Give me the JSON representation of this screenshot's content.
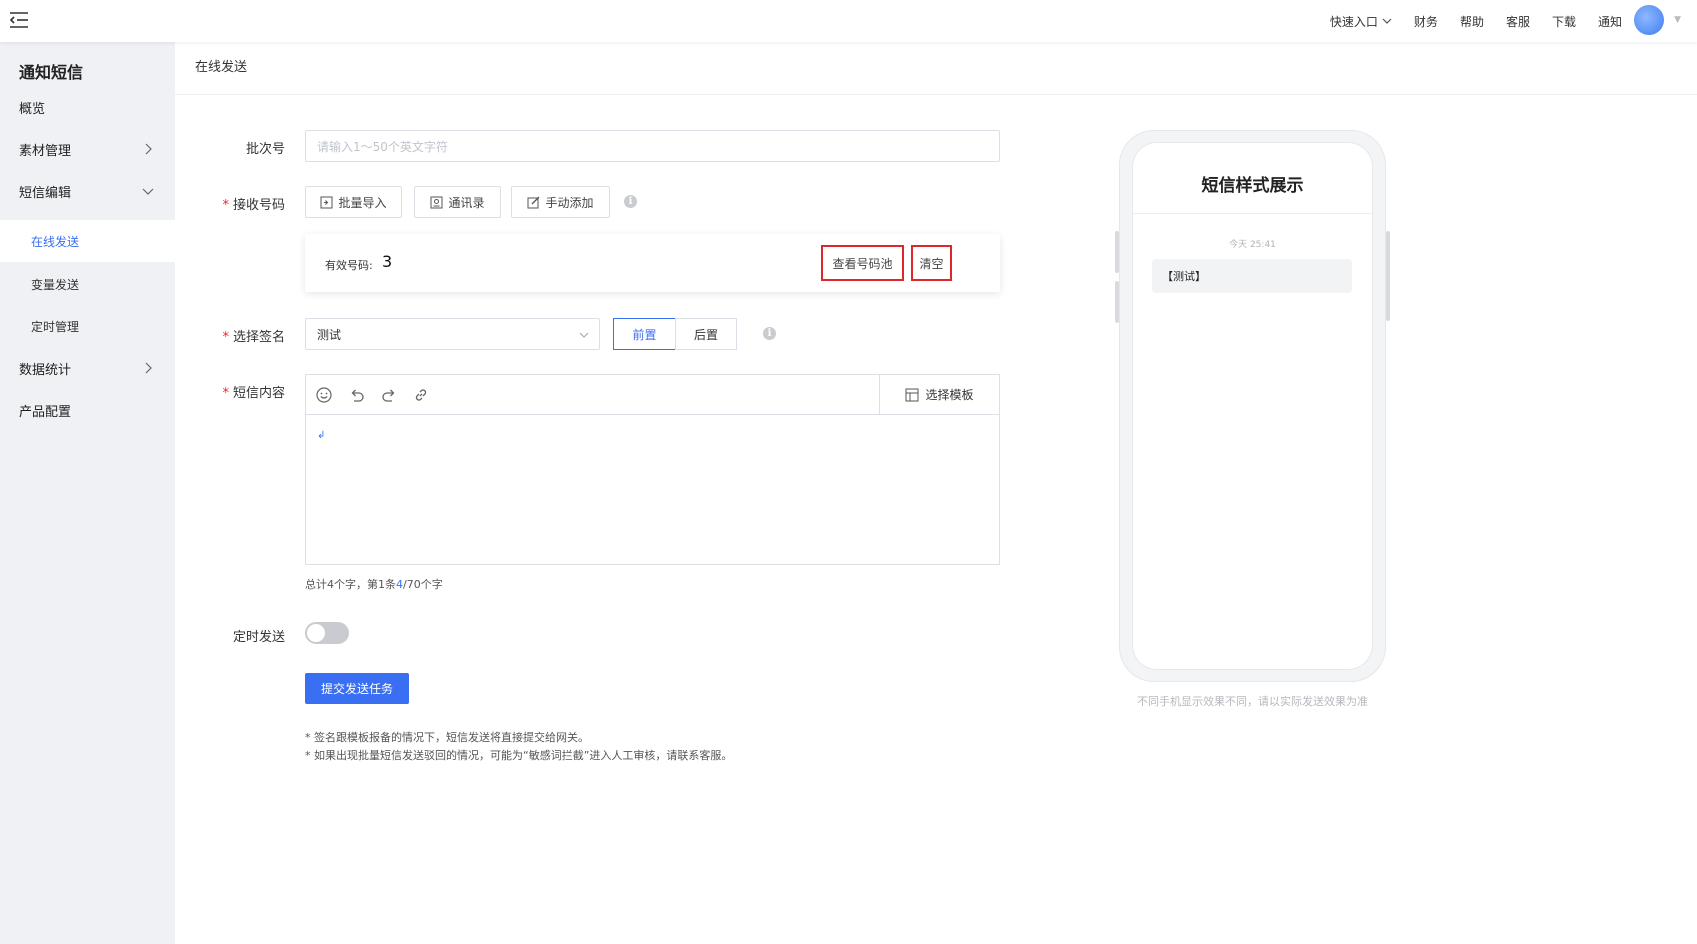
{
  "topbar": {
    "nav": [
      {
        "label": "快速入口",
        "has_caret": true
      },
      {
        "label": "财务"
      },
      {
        "label": "帮助"
      },
      {
        "label": "客服"
      },
      {
        "label": "下载"
      },
      {
        "label": "通知"
      }
    ],
    "avatar_color": "#3d7ef0"
  },
  "sidebar": {
    "title": "通知短信",
    "items": [
      {
        "label": "概览"
      },
      {
        "label": "素材管理",
        "arrow": "chevron-right-icon"
      },
      {
        "label": "短信编辑",
        "arrow": "chevron-down-icon"
      },
      {
        "label": "在线发送",
        "active": true
      },
      {
        "label": "变量发送"
      },
      {
        "label": "定时管理"
      },
      {
        "label": "数据统计",
        "arrow": "chevron-right-icon"
      },
      {
        "label": "产品配置"
      }
    ]
  },
  "main": {
    "breadcrumb": "在线发送",
    "form": {
      "batch_label": "批次号",
      "batch_placeholder": "请输入1～50个英文字符",
      "receiver_label": "接收号码",
      "import_buttons": [
        {
          "label": "批量导入",
          "icon": "import-icon"
        },
        {
          "label": "通讯录",
          "icon": "contacts-icon"
        },
        {
          "label": "手动添加",
          "icon": "edit-icon"
        }
      ],
      "valid_label": "有效号码:",
      "valid_count": "3",
      "view_pool": "查看号码池",
      "clear": "清空",
      "signature_label": "选择签名",
      "signature_value": "测试",
      "position_options": [
        "前置",
        "后置"
      ],
      "position_selected": "前置",
      "content_label": "短信内容",
      "template_button": "选择模板",
      "editor_tools": [
        "emoji-icon",
        "undo-icon",
        "redo-icon",
        "link-icon"
      ],
      "char_count_prefix": "总计4个字，第1条",
      "char_count_highlight": "4",
      "char_count_suffix": "/70个字",
      "schedule_label": "定时发送",
      "schedule_on": false,
      "submit": "提交发送任务",
      "notes": [
        "* 签名跟模板报备的情况下，短信发送将直接提交给网关。",
        "* 如果出现批量短信发送驳回的情况，可能为“敏感词拦截”进入人工审核，请联系客服。"
      ]
    },
    "preview": {
      "title": "短信样式展示",
      "time": "今天 25:41",
      "message": "【测试】",
      "note": "不同手机显示效果不同，请以实际发送效果为准"
    }
  },
  "colors": {
    "accent": "#3a6ff3",
    "required": "#f5222d",
    "highlight_box": "#e0262b"
  }
}
